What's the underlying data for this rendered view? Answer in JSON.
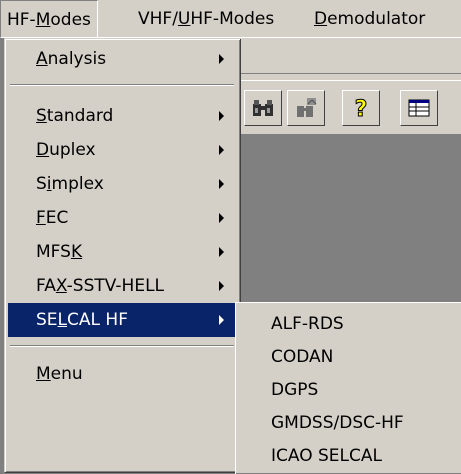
{
  "menubar": {
    "items": [
      {
        "pre": "HF-",
        "ul": "M",
        "post": "odes"
      },
      {
        "pre": "VHF/",
        "ul": "U",
        "post": "HF-Modes"
      },
      {
        "pre": "",
        "ul": "D",
        "post": "emodulator"
      }
    ]
  },
  "menu": {
    "items": [
      {
        "pre": "",
        "ul": "A",
        "post": "nalysis",
        "submenu": true
      },
      {
        "pre": "",
        "ul": "S",
        "post": "tandard",
        "submenu": true
      },
      {
        "pre": "",
        "ul": "D",
        "post": "uplex",
        "submenu": true
      },
      {
        "pre": "S",
        "ul": "i",
        "post": "mplex",
        "submenu": true
      },
      {
        "pre": "",
        "ul": "F",
        "post": "EC",
        "submenu": true
      },
      {
        "pre": "MFS",
        "ul": "K",
        "post": "",
        "submenu": true
      },
      {
        "pre": "FA",
        "ul": "X",
        "post": "-SSTV-HELL",
        "submenu": true
      },
      {
        "pre": "SE",
        "ul": "L",
        "post": "CAL HF",
        "submenu": true,
        "highlighted": true
      },
      {
        "pre": "",
        "ul": "M",
        "post": "enu",
        "submenu": false
      }
    ]
  },
  "submenu": {
    "items": [
      "ALF-RDS",
      "CODAN",
      "DGPS",
      "GMDSS/DSC-HF",
      "ICAO SELCAL"
    ]
  },
  "toolbar": {
    "icons": [
      "binoculars-icon",
      "find-replace-icon",
      "help-icon",
      "grid-icon"
    ]
  },
  "colors": {
    "highlight": "#0a246a",
    "face": "#d4d0c8",
    "workspace": "#808080",
    "help_yellow": "#ffff00"
  }
}
